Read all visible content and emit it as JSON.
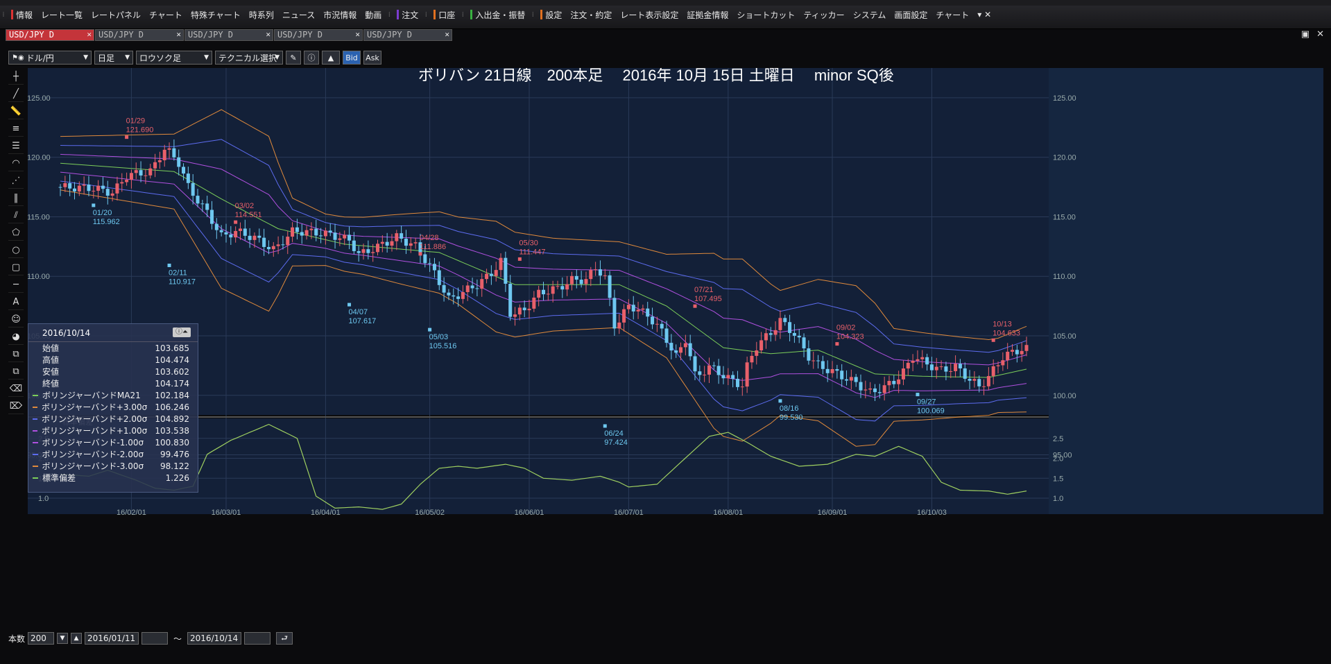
{
  "menubar": {
    "items": [
      "情報",
      "レート一覧",
      "レートパネル",
      "チャート",
      "特殊チャート",
      "時系列",
      "ニュース",
      "市況情報",
      "動画",
      "注文",
      "口座",
      "入出金・振替",
      "設定",
      "注文・約定",
      "レート表示設定",
      "証拠金情報",
      "ショートカット",
      "ティッカー",
      "システム",
      "画面設定",
      "チャート"
    ]
  },
  "tabs": [
    {
      "label": "USD/JPY D",
      "active": true
    },
    {
      "label": "USD/JPY D",
      "active": false
    },
    {
      "label": "USD/JPY D",
      "active": false
    },
    {
      "label": "USD/JPY D",
      "active": false
    },
    {
      "label": "USD/JPY D",
      "active": false
    }
  ],
  "toolbar": {
    "pair": "ドル/円",
    "timeframe": "日足",
    "chart_type": "ロウソク足",
    "technical": "テクニカル選択",
    "bid": "Bid",
    "ask": "Ask"
  },
  "chart_title": "ボリバン 21日線　200本足　 2016年 10月 15日 土曜日　 minor SQ後",
  "info_panel": {
    "date": "2016/10/14",
    "rows": [
      {
        "label": "始値",
        "value": "103.685",
        "color": ""
      },
      {
        "label": "高値",
        "value": "104.474",
        "color": ""
      },
      {
        "label": "安値",
        "value": "103.602",
        "color": ""
      },
      {
        "label": "終値",
        "value": "104.174",
        "color": ""
      },
      {
        "label": "ボリンジャーバンドMA21",
        "value": "102.184",
        "color": "#7ccf5a"
      },
      {
        "label": "ボリンジャーバンド+3.00σ",
        "value": "106.246",
        "color": "#e08a3c"
      },
      {
        "label": "ボリンジャーバンド+2.00σ",
        "value": "104.892",
        "color": "#5d6cf0"
      },
      {
        "label": "ボリンジャーバンド+1.00σ",
        "value": "103.538",
        "color": "#b050e0"
      },
      {
        "label": "ボリンジャーバンド-1.00σ",
        "value": "100.830",
        "color": "#b050e0"
      },
      {
        "label": "ボリンジャーバンド-2.00σ",
        "value": "99.476",
        "color": "#5d6cf0"
      },
      {
        "label": "ボリンジャーバンド-3.00σ",
        "value": "98.122",
        "color": "#e08a3c"
      },
      {
        "label": "標準偏差",
        "value": "1.226",
        "color": "#7ccf5a"
      }
    ]
  },
  "bottombar": {
    "count_label": "本数",
    "count": "200",
    "from": "2016/01/11",
    "tilde": "～",
    "to": "2016/10/14"
  },
  "chart_data": {
    "type": "candlestick",
    "main_yticks": [
      125.0,
      120.0,
      115.0,
      110.0,
      105.0,
      100.0,
      95.0
    ],
    "main_ylim": [
      92.7,
      127.5
    ],
    "sub_title": "標準偏差",
    "sub_yticks": [
      2.5,
      2.0,
      1.5,
      1.0
    ],
    "sub_ylim": [
      0.6,
      3.0
    ],
    "xticks": [
      "16/02/01",
      "16/03/01",
      "16/04/01",
      "16/05/02",
      "16/06/01",
      "16/07/01",
      "16/08/01",
      "16/09/01",
      "16/10/03"
    ],
    "price_anchors": [
      [
        0,
        117.5
      ],
      [
        8,
        117.4
      ],
      [
        12,
        117.0
      ],
      [
        15,
        118.5
      ],
      [
        20,
        118.8
      ],
      [
        23,
        120.8
      ],
      [
        26,
        119.5
      ],
      [
        28,
        117.4
      ],
      [
        32,
        115.3
      ],
      [
        35,
        113.3
      ],
      [
        38,
        113.8
      ],
      [
        42,
        113.2
      ],
      [
        46,
        112.2
      ],
      [
        50,
        113.8
      ],
      [
        54,
        113.7
      ],
      [
        58,
        113.5
      ],
      [
        62,
        113.0
      ],
      [
        64,
        111.8
      ],
      [
        68,
        112.5
      ],
      [
        72,
        113.3
      ],
      [
        76,
        112.5
      ],
      [
        80,
        110.2
      ],
      [
        83,
        108.0
      ],
      [
        86,
        108.7
      ],
      [
        89,
        109.3
      ],
      [
        92,
        110.3
      ],
      [
        94,
        111.3
      ],
      [
        96,
        106.7
      ],
      [
        99,
        107.2
      ],
      [
        102,
        108.6
      ],
      [
        106,
        109.0
      ],
      [
        109,
        109.7
      ],
      [
        112,
        109.7
      ],
      [
        114,
        110.8
      ],
      [
        116,
        109.8
      ],
      [
        118,
        105.7
      ],
      [
        121,
        107.6
      ],
      [
        125,
        106.7
      ],
      [
        128,
        105.3
      ],
      [
        131,
        103.2
      ],
      [
        133,
        104.8
      ],
      [
        135,
        101.5
      ],
      [
        138,
        102.4
      ],
      [
        142,
        101.4
      ],
      [
        145,
        100.8
      ],
      [
        146,
        102.6
      ],
      [
        148,
        104.2
      ],
      [
        151,
        105.3
      ],
      [
        153,
        106.3
      ],
      [
        156,
        105.1
      ],
      [
        159,
        103.2
      ],
      [
        161,
        102.5
      ],
      [
        165,
        101.8
      ],
      [
        169,
        101.0
      ],
      [
        172,
        100.2
      ],
      [
        175,
        100.7
      ],
      [
        177,
        101.2
      ],
      [
        179,
        102.0
      ],
      [
        181,
        103.3
      ],
      [
        184,
        102.6
      ],
      [
        187,
        102.1
      ],
      [
        190,
        102.4
      ],
      [
        193,
        101.3
      ],
      [
        195,
        100.7
      ],
      [
        197,
        101.6
      ],
      [
        200,
        103.3
      ],
      [
        204,
        103.9
      ]
    ],
    "bb_mid": [
      [
        0,
        119.5
      ],
      [
        24,
        118.8
      ],
      [
        34,
        116.5
      ],
      [
        46,
        114.0
      ],
      [
        60,
        112.7
      ],
      [
        80,
        112.0
      ],
      [
        96,
        109.3
      ],
      [
        118,
        109.3
      ],
      [
        128,
        107.5
      ],
      [
        140,
        104.0
      ],
      [
        150,
        103.5
      ],
      [
        160,
        103.8
      ],
      [
        172,
        101.8
      ],
      [
        182,
        101.6
      ],
      [
        196,
        101.5
      ],
      [
        204,
        102.2
      ]
    ],
    "bb_sd": [
      [
        0,
        0.75
      ],
      [
        24,
        1.05
      ],
      [
        34,
        2.5
      ],
      [
        44,
        2.45
      ],
      [
        49,
        0.95
      ],
      [
        56,
        0.72
      ],
      [
        64,
        0.8
      ],
      [
        72,
        0.98
      ],
      [
        84,
        1.22
      ],
      [
        92,
        1.55
      ],
      [
        104,
        1.3
      ],
      [
        118,
        1.2
      ],
      [
        128,
        1.45
      ],
      [
        138,
        2.45
      ],
      [
        144,
        2.55
      ],
      [
        152,
        1.75
      ],
      [
        160,
        1.98
      ],
      [
        168,
        2.25
      ],
      [
        172,
        1.98
      ],
      [
        176,
        1.3
      ],
      [
        190,
        1.12
      ],
      [
        198,
        1.04
      ],
      [
        204,
        1.2
      ]
    ],
    "std_panel": [
      [
        0,
        1.6
      ],
      [
        6,
        1.55
      ],
      [
        10,
        1.7
      ],
      [
        16,
        1.45
      ],
      [
        20,
        1.25
      ],
      [
        24,
        1.2
      ],
      [
        28,
        1.3
      ],
      [
        31,
        2.1
      ],
      [
        36,
        2.45
      ],
      [
        44,
        2.85
      ],
      [
        50,
        2.5
      ],
      [
        54,
        1.05
      ],
      [
        58,
        0.75
      ],
      [
        63,
        0.78
      ],
      [
        68,
        0.72
      ],
      [
        72,
        0.85
      ],
      [
        76,
        1.35
      ],
      [
        80,
        1.75
      ],
      [
        84,
        1.8
      ],
      [
        88,
        1.75
      ],
      [
        94,
        1.85
      ],
      [
        98,
        1.75
      ],
      [
        102,
        1.5
      ],
      [
        108,
        1.45
      ],
      [
        114,
        1.55
      ],
      [
        118,
        1.4
      ],
      [
        120,
        1.28
      ],
      [
        126,
        1.35
      ],
      [
        131,
        1.9
      ],
      [
        137,
        2.55
      ],
      [
        141,
        2.65
      ],
      [
        145,
        2.4
      ],
      [
        150,
        2.05
      ],
      [
        156,
        1.8
      ],
      [
        162,
        1.85
      ],
      [
        168,
        2.1
      ],
      [
        172,
        2.05
      ],
      [
        177,
        2.3
      ],
      [
        182,
        2.05
      ],
      [
        186,
        1.4
      ],
      [
        190,
        1.2
      ],
      [
        196,
        1.18
      ],
      [
        200,
        1.1
      ],
      [
        204,
        1.18
      ]
    ],
    "annotations": [
      {
        "label": "01/29",
        "value": "121.690",
        "kind": "high"
      },
      {
        "label": "01/20",
        "value": "115.962",
        "kind": "low"
      },
      {
        "label": "02/11",
        "value": "110.917",
        "kind": "low"
      },
      {
        "label": "03/02",
        "value": "114.551",
        "kind": "high"
      },
      {
        "label": "04/07",
        "value": "107.617",
        "kind": "low"
      },
      {
        "label": "04/28",
        "value": "111.886",
        "kind": "high"
      },
      {
        "label": "05/03",
        "value": "105.516",
        "kind": "low"
      },
      {
        "label": "05/30",
        "value": "111.447",
        "kind": "high"
      },
      {
        "label": "06/24",
        "value": "97.424",
        "kind": "low"
      },
      {
        "label": "07/21",
        "value": "107.495",
        "kind": "high"
      },
      {
        "label": "08/16",
        "value": "99.530",
        "kind": "low"
      },
      {
        "label": "09/02",
        "value": "104.323",
        "kind": "high"
      },
      {
        "label": "09/27",
        "value": "100.069",
        "kind": "low"
      },
      {
        "label": "10/13",
        "value": "104.633",
        "kind": "high"
      }
    ],
    "colors": {
      "up": "#e8606a",
      "down": "#6ec8f0",
      "mid": "#7ccf5a",
      "sd1": "#b050e0",
      "sd2": "#5d6cf0",
      "sd3": "#e08a3c",
      "std": "#9fd060"
    }
  }
}
